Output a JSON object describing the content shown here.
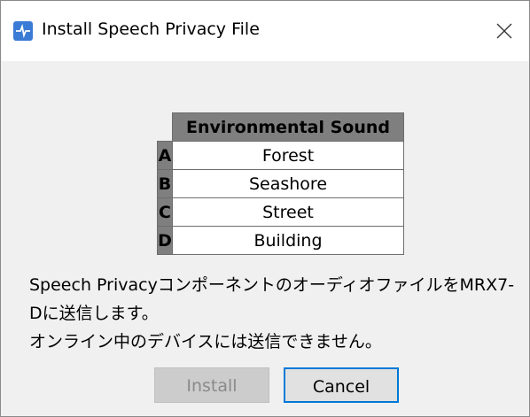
{
  "window": {
    "title": "Install Speech Privacy File"
  },
  "table": {
    "header": "Environmental Sound",
    "rows": [
      {
        "key": "A",
        "value": "Forest"
      },
      {
        "key": "B",
        "value": "Seashore"
      },
      {
        "key": "C",
        "value": "Street"
      },
      {
        "key": "D",
        "value": "Building"
      }
    ]
  },
  "message": {
    "line1": "Speech Privacyコンポーネントのオーディオファイルを",
    "line1b": "MRX7-D",
    "line1c": "に送信します。",
    "line2": "オンライン中のデバイスには送信できません。"
  },
  "buttons": {
    "install_label": "Install",
    "cancel_label": "Cancel"
  },
  "icons": {
    "app": "app-icon",
    "close": "close-icon"
  },
  "colors": {
    "accent": "#0078d7",
    "table_header": "#7f7f7f",
    "disabled_text": "#8a8a8a"
  }
}
